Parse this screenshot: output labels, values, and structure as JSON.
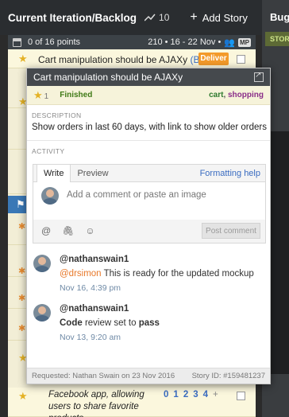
{
  "panel": {
    "title": "Current Iteration/Backlog",
    "velocity_icon": "trend-icon",
    "velocity": "10",
    "add_story_label": "Add Story"
  },
  "bugs_panel": {
    "title": "Bugs",
    "stories_label": "STORIES"
  },
  "iteration": {
    "points": "0 of 16 points",
    "info": "210 • 16 - 22 Nov •",
    "owner_badge": "MP"
  },
  "story_rows": {
    "first": {
      "title": "Cart manipulation should be AJAXy",
      "owner": "(BR)",
      "button_label": "Deliver"
    },
    "last": {
      "title": "Facebook app, allowing users to share favorite products",
      "estimates": [
        "0",
        "1",
        "2",
        "3",
        "4",
        "+"
      ]
    }
  },
  "story_detail": {
    "title": "Cart manipulation should be AJAXy",
    "estimate": "1",
    "state": "Finished",
    "labels": [
      "cart",
      "shopping"
    ],
    "description_label": "DESCRIPTION",
    "description": "Show orders in last 60 days, with link to show older orders",
    "activity_label": "ACTIVITY",
    "editor": {
      "tab_write": "Write",
      "tab_preview": "Preview",
      "formatting_help": "Formatting help",
      "placeholder": "Add a comment or paste an image",
      "post_button": "Post comment"
    },
    "comments": [
      {
        "author": "@nathanswain1",
        "mention": "@drsimon",
        "text": " This is ready for the updated mockup",
        "time": "Nov 16, 4:39 pm"
      },
      {
        "author": "@nathanswain1",
        "bold": "Code",
        "text": " review set to ",
        "bold2": "pass",
        "time": "Nov 13, 9:20 am"
      }
    ],
    "footer": {
      "requested": "Requested: Nathan Swain on 23 Nov 2016",
      "story_id": "Story ID: #159481237"
    }
  }
}
